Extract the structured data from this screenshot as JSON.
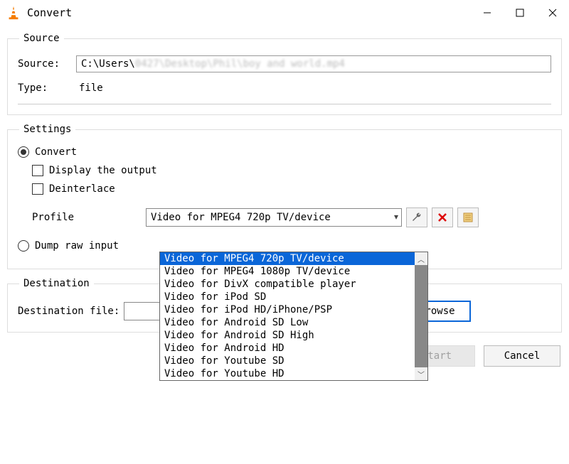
{
  "window": {
    "title": "Convert"
  },
  "source_section": {
    "legend": "Source",
    "source_label": "Source:",
    "source_value": "C:\\Users\\",
    "source_value_blur": "0427\\Desktop\\Phil\\boy and world.mp4",
    "type_label": "Type:",
    "type_value": "file"
  },
  "settings_section": {
    "legend": "Settings",
    "convert_radio": "Convert",
    "display_output": "Display the output",
    "deinterlace": "Deinterlace",
    "profile_label": "Profile",
    "profile_selected": "Video for MPEG4 720p TV/device",
    "profile_options": [
      "Video for MPEG4 720p TV/device",
      "Video for MPEG4 1080p TV/device",
      "Video for DivX compatible player",
      "Video for iPod SD",
      "Video for iPod HD/iPhone/PSP",
      "Video for Android SD Low",
      "Video for Android SD High",
      "Video for Android HD",
      "Video for Youtube SD",
      "Video for Youtube HD"
    ],
    "dump_raw": "Dump raw input"
  },
  "destination_section": {
    "legend": "Destination",
    "label": "Destination file:",
    "value": "",
    "browse": "Browse"
  },
  "buttons": {
    "start": "Start",
    "cancel": "Cancel"
  }
}
